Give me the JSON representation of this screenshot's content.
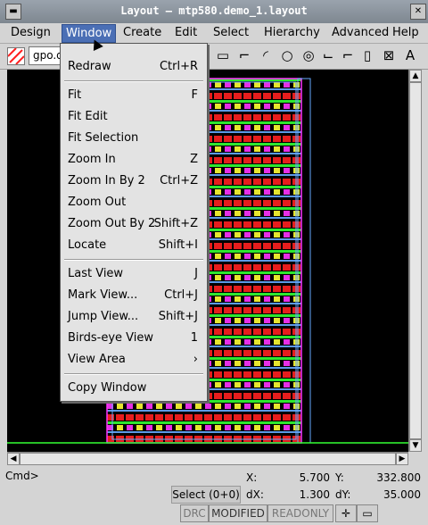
{
  "window": {
    "title": "Layout – mtp580.demo_1.layout"
  },
  "menubar": {
    "items": [
      "Design",
      "Window",
      "Create",
      "Edit",
      "Select",
      "Hierarchy",
      "Advanced",
      "Help"
    ],
    "active": "Window"
  },
  "toolbar": {
    "layer": "gpo.d",
    "tool_icons": [
      "rectangle-tool",
      "polygon-tool",
      "arc-tool",
      "circle-tool",
      "ring-tool",
      "path-tool",
      "wire-tool",
      "device-tool",
      "pin-tool",
      "text-tool"
    ]
  },
  "window_menu": {
    "items": [
      {
        "label": "Redraw",
        "accel": "Ctrl+R"
      },
      {
        "label": "Fit",
        "accel": "F"
      },
      {
        "label": "Fit Edit",
        "accel": ""
      },
      {
        "label": "Fit Selection",
        "accel": ""
      },
      {
        "label": "Zoom In",
        "accel": "Z"
      },
      {
        "label": "Zoom In By 2",
        "accel": "Ctrl+Z"
      },
      {
        "label": "Zoom Out",
        "accel": ""
      },
      {
        "label": "Zoom Out By 2",
        "accel": "Shift+Z"
      },
      {
        "label": "Locate",
        "accel": "Shift+I"
      },
      {
        "label": "Last View",
        "accel": "J"
      },
      {
        "label": "Mark View...",
        "accel": "Ctrl+J"
      },
      {
        "label": "Jump View...",
        "accel": "Shift+J"
      },
      {
        "label": "Birds-eye View",
        "accel": "1"
      },
      {
        "label": "View Area",
        "accel": "›"
      },
      {
        "label": "Copy Window",
        "accel": ""
      }
    ]
  },
  "status": {
    "cmd_label": "Cmd>",
    "x_label": "X:",
    "x_value": "5.700",
    "y_label": "Y:",
    "y_value": "332.800",
    "select_label": "Select (0+0)",
    "dx_label": "dX:",
    "dx_value": "1.300",
    "dy_label": "dY:",
    "dy_value": "35.000",
    "badges": [
      "DRC",
      "MODIFIED",
      "READONLY"
    ]
  },
  "colors": {
    "canvas_bg": "#000000",
    "menu_highlight": "#4b6fb5",
    "layout_red": "#ff2020",
    "layout_green": "#33ff33",
    "layout_magenta": "#ff33ff",
    "layout_blue": "#66aaff",
    "layout_yellow": "#ffff33"
  }
}
